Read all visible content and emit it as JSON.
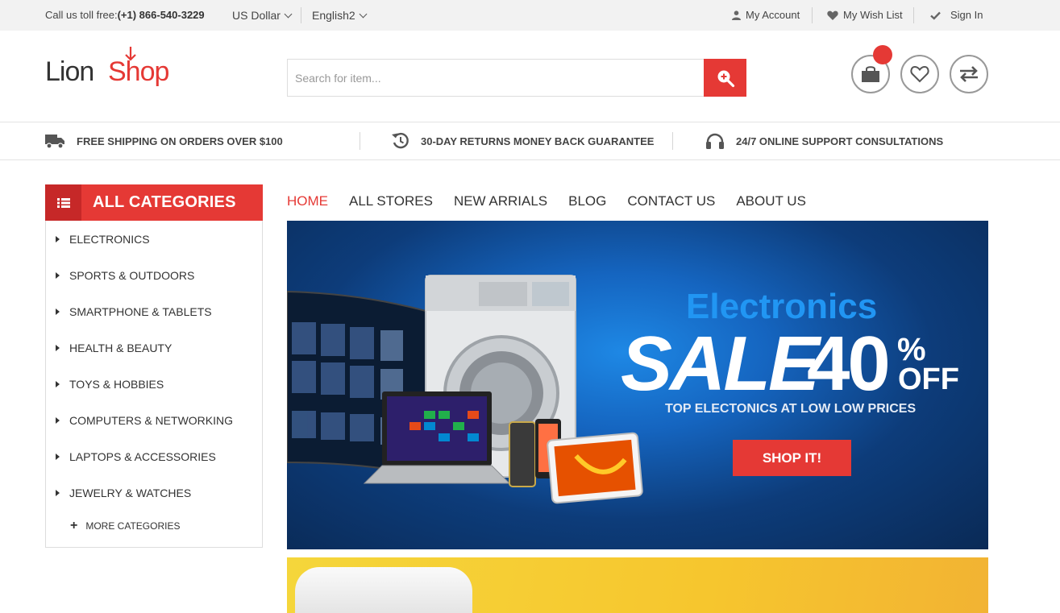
{
  "topbar": {
    "phone_label": "Call us toll free:",
    "phone_number": "(+1) 866-540-3229",
    "currency": "US Dollar",
    "language": "English2",
    "account": "My Account",
    "wishlist": "My Wish List",
    "signin": "Sign In"
  },
  "header": {
    "logo_part1": "Lion",
    "logo_part2": "Shop",
    "search_placeholder": "Search for item...",
    "icons": [
      "cart-icon",
      "heart-icon",
      "compare-icon"
    ]
  },
  "features": [
    {
      "icon": "truck-icon",
      "label": "FREE SHIPPING ON ORDERS OVER $100"
    },
    {
      "icon": "returns-icon",
      "label": "30-DAY RETURNS MONEY BACK GUARANTEE"
    },
    {
      "icon": "headphones-icon",
      "label": "24/7 ONLINE SUPPORT CONSULTATIONS"
    }
  ],
  "categories": {
    "title": "ALL CATEGORIES",
    "items": [
      "ELECTRONICS",
      "SPORTS & OUTDOORS",
      "SMARTPHONE & TABLETS",
      "HEALTH & BEAUTY",
      "TOYS & HOBBIES",
      "COMPUTERS & NETWORKING",
      "LAPTOPS & ACCESSORIES",
      "JEWELRY & WATCHES"
    ],
    "more": "MORE CATEGORIES"
  },
  "nav": {
    "items": [
      "HOME",
      "ALL STORES",
      "NEW ARRIALS",
      "BLOG",
      "CONTACT US",
      "ABOUT US"
    ],
    "active": "HOME"
  },
  "banner": {
    "title": "Electronics",
    "sale": "SALE",
    "percent": "40",
    "percent_sign": "%",
    "off": "OFF",
    "subtitle": "TOP ELECTONICS AT LOW LOW PRICES",
    "button": "SHOP IT!"
  },
  "colors": {
    "accent": "#e53935",
    "banner_blue": "#0d3c7a",
    "title_blue": "#2196f3"
  }
}
